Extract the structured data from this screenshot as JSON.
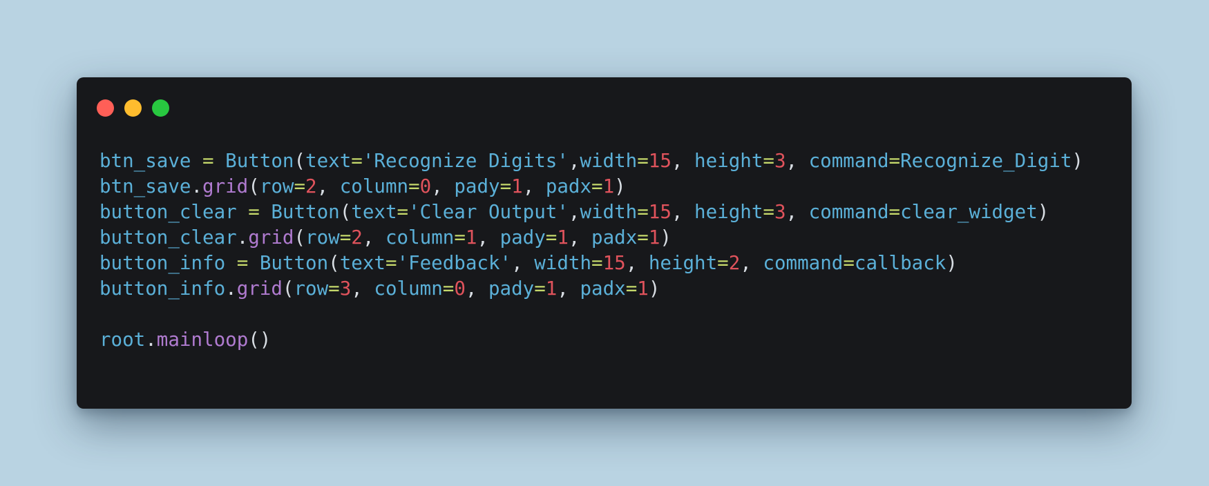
{
  "colors": {
    "background": "#b9d3e2",
    "window": "#17181b",
    "close": "#ff5f57",
    "minimize": "#febc2e",
    "maximize": "#28c840",
    "identifier": "#5bb0d8",
    "operator": "#c5d86b",
    "number": "#e0535c",
    "method": "#b07bd0",
    "punctuation": "#d8dde3"
  },
  "window_controls": [
    "close-dot",
    "minimize-dot",
    "maximize-dot"
  ],
  "code": {
    "lines": [
      [
        {
          "t": "btn_save",
          "k": "id"
        },
        {
          "t": " ",
          "k": "id"
        },
        {
          "t": "=",
          "k": "op"
        },
        {
          "t": " ",
          "k": "id"
        },
        {
          "t": "Button",
          "k": "id"
        },
        {
          "t": "(",
          "k": "punc"
        },
        {
          "t": "text",
          "k": "id"
        },
        {
          "t": "=",
          "k": "op"
        },
        {
          "t": "'Recognize Digits'",
          "k": "str"
        },
        {
          "t": ",",
          "k": "punc"
        },
        {
          "t": "width",
          "k": "id"
        },
        {
          "t": "=",
          "k": "op"
        },
        {
          "t": "15",
          "k": "num"
        },
        {
          "t": ", ",
          "k": "punc"
        },
        {
          "t": "height",
          "k": "id"
        },
        {
          "t": "=",
          "k": "op"
        },
        {
          "t": "3",
          "k": "num"
        },
        {
          "t": ", ",
          "k": "punc"
        },
        {
          "t": "command",
          "k": "id"
        },
        {
          "t": "=",
          "k": "op"
        },
        {
          "t": "Recognize_Digit",
          "k": "id"
        },
        {
          "t": ")",
          "k": "punc"
        }
      ],
      [
        {
          "t": "btn_save",
          "k": "id"
        },
        {
          "t": ".",
          "k": "punc"
        },
        {
          "t": "grid",
          "k": "fn"
        },
        {
          "t": "(",
          "k": "punc"
        },
        {
          "t": "row",
          "k": "id"
        },
        {
          "t": "=",
          "k": "op"
        },
        {
          "t": "2",
          "k": "num"
        },
        {
          "t": ", ",
          "k": "punc"
        },
        {
          "t": "column",
          "k": "id"
        },
        {
          "t": "=",
          "k": "op"
        },
        {
          "t": "0",
          "k": "num"
        },
        {
          "t": ", ",
          "k": "punc"
        },
        {
          "t": "pady",
          "k": "id"
        },
        {
          "t": "=",
          "k": "op"
        },
        {
          "t": "1",
          "k": "num"
        },
        {
          "t": ", ",
          "k": "punc"
        },
        {
          "t": "padx",
          "k": "id"
        },
        {
          "t": "=",
          "k": "op"
        },
        {
          "t": "1",
          "k": "num"
        },
        {
          "t": ")",
          "k": "punc"
        }
      ],
      [
        {
          "t": "button_clear",
          "k": "id"
        },
        {
          "t": " ",
          "k": "id"
        },
        {
          "t": "=",
          "k": "op"
        },
        {
          "t": " ",
          "k": "id"
        },
        {
          "t": "Button",
          "k": "id"
        },
        {
          "t": "(",
          "k": "punc"
        },
        {
          "t": "text",
          "k": "id"
        },
        {
          "t": "=",
          "k": "op"
        },
        {
          "t": "'Clear Output'",
          "k": "str"
        },
        {
          "t": ",",
          "k": "punc"
        },
        {
          "t": "width",
          "k": "id"
        },
        {
          "t": "=",
          "k": "op"
        },
        {
          "t": "15",
          "k": "num"
        },
        {
          "t": ", ",
          "k": "punc"
        },
        {
          "t": "height",
          "k": "id"
        },
        {
          "t": "=",
          "k": "op"
        },
        {
          "t": "3",
          "k": "num"
        },
        {
          "t": ", ",
          "k": "punc"
        },
        {
          "t": "command",
          "k": "id"
        },
        {
          "t": "=",
          "k": "op"
        },
        {
          "t": "clear_widget",
          "k": "id"
        },
        {
          "t": ")",
          "k": "punc"
        }
      ],
      [
        {
          "t": "button_clear",
          "k": "id"
        },
        {
          "t": ".",
          "k": "punc"
        },
        {
          "t": "grid",
          "k": "fn"
        },
        {
          "t": "(",
          "k": "punc"
        },
        {
          "t": "row",
          "k": "id"
        },
        {
          "t": "=",
          "k": "op"
        },
        {
          "t": "2",
          "k": "num"
        },
        {
          "t": ", ",
          "k": "punc"
        },
        {
          "t": "column",
          "k": "id"
        },
        {
          "t": "=",
          "k": "op"
        },
        {
          "t": "1",
          "k": "num"
        },
        {
          "t": ", ",
          "k": "punc"
        },
        {
          "t": "pady",
          "k": "id"
        },
        {
          "t": "=",
          "k": "op"
        },
        {
          "t": "1",
          "k": "num"
        },
        {
          "t": ", ",
          "k": "punc"
        },
        {
          "t": "padx",
          "k": "id"
        },
        {
          "t": "=",
          "k": "op"
        },
        {
          "t": "1",
          "k": "num"
        },
        {
          "t": ")",
          "k": "punc"
        }
      ],
      [
        {
          "t": "button_info",
          "k": "id"
        },
        {
          "t": " ",
          "k": "id"
        },
        {
          "t": "=",
          "k": "op"
        },
        {
          "t": " ",
          "k": "id"
        },
        {
          "t": "Button",
          "k": "id"
        },
        {
          "t": "(",
          "k": "punc"
        },
        {
          "t": "text",
          "k": "id"
        },
        {
          "t": "=",
          "k": "op"
        },
        {
          "t": "'Feedback'",
          "k": "str"
        },
        {
          "t": ", ",
          "k": "punc"
        },
        {
          "t": "width",
          "k": "id"
        },
        {
          "t": "=",
          "k": "op"
        },
        {
          "t": "15",
          "k": "num"
        },
        {
          "t": ", ",
          "k": "punc"
        },
        {
          "t": "height",
          "k": "id"
        },
        {
          "t": "=",
          "k": "op"
        },
        {
          "t": "2",
          "k": "num"
        },
        {
          "t": ", ",
          "k": "punc"
        },
        {
          "t": "command",
          "k": "id"
        },
        {
          "t": "=",
          "k": "op"
        },
        {
          "t": "callback",
          "k": "id"
        },
        {
          "t": ")",
          "k": "punc"
        }
      ],
      [
        {
          "t": "button_info",
          "k": "id"
        },
        {
          "t": ".",
          "k": "punc"
        },
        {
          "t": "grid",
          "k": "fn"
        },
        {
          "t": "(",
          "k": "punc"
        },
        {
          "t": "row",
          "k": "id"
        },
        {
          "t": "=",
          "k": "op"
        },
        {
          "t": "3",
          "k": "num"
        },
        {
          "t": ", ",
          "k": "punc"
        },
        {
          "t": "column",
          "k": "id"
        },
        {
          "t": "=",
          "k": "op"
        },
        {
          "t": "0",
          "k": "num"
        },
        {
          "t": ", ",
          "k": "punc"
        },
        {
          "t": "pady",
          "k": "id"
        },
        {
          "t": "=",
          "k": "op"
        },
        {
          "t": "1",
          "k": "num"
        },
        {
          "t": ", ",
          "k": "punc"
        },
        {
          "t": "padx",
          "k": "id"
        },
        {
          "t": "=",
          "k": "op"
        },
        {
          "t": "1",
          "k": "num"
        },
        {
          "t": ")",
          "k": "punc"
        }
      ],
      [],
      [
        {
          "t": "root",
          "k": "id"
        },
        {
          "t": ".",
          "k": "punc"
        },
        {
          "t": "mainloop",
          "k": "fn"
        },
        {
          "t": "()",
          "k": "punc"
        }
      ]
    ]
  }
}
